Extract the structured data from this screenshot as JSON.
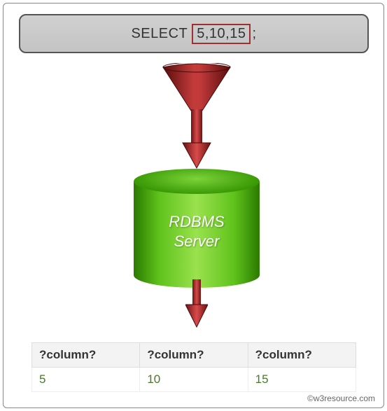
{
  "sql": {
    "keyword": "SELECT",
    "values_boxed": "5,10,15",
    "terminator": ";"
  },
  "server": {
    "line1": "RDBMS",
    "line2": "Server"
  },
  "result": {
    "headers": [
      "?column?",
      "?column?",
      "?column?"
    ],
    "row": [
      "5",
      "10",
      "15"
    ]
  },
  "attribution": "©w3resource.com",
  "colors": {
    "arrow_fill": "#8a1a1a",
    "arrow_highlight": "#d84a4a",
    "cylinder_green": "#5fc21b"
  }
}
